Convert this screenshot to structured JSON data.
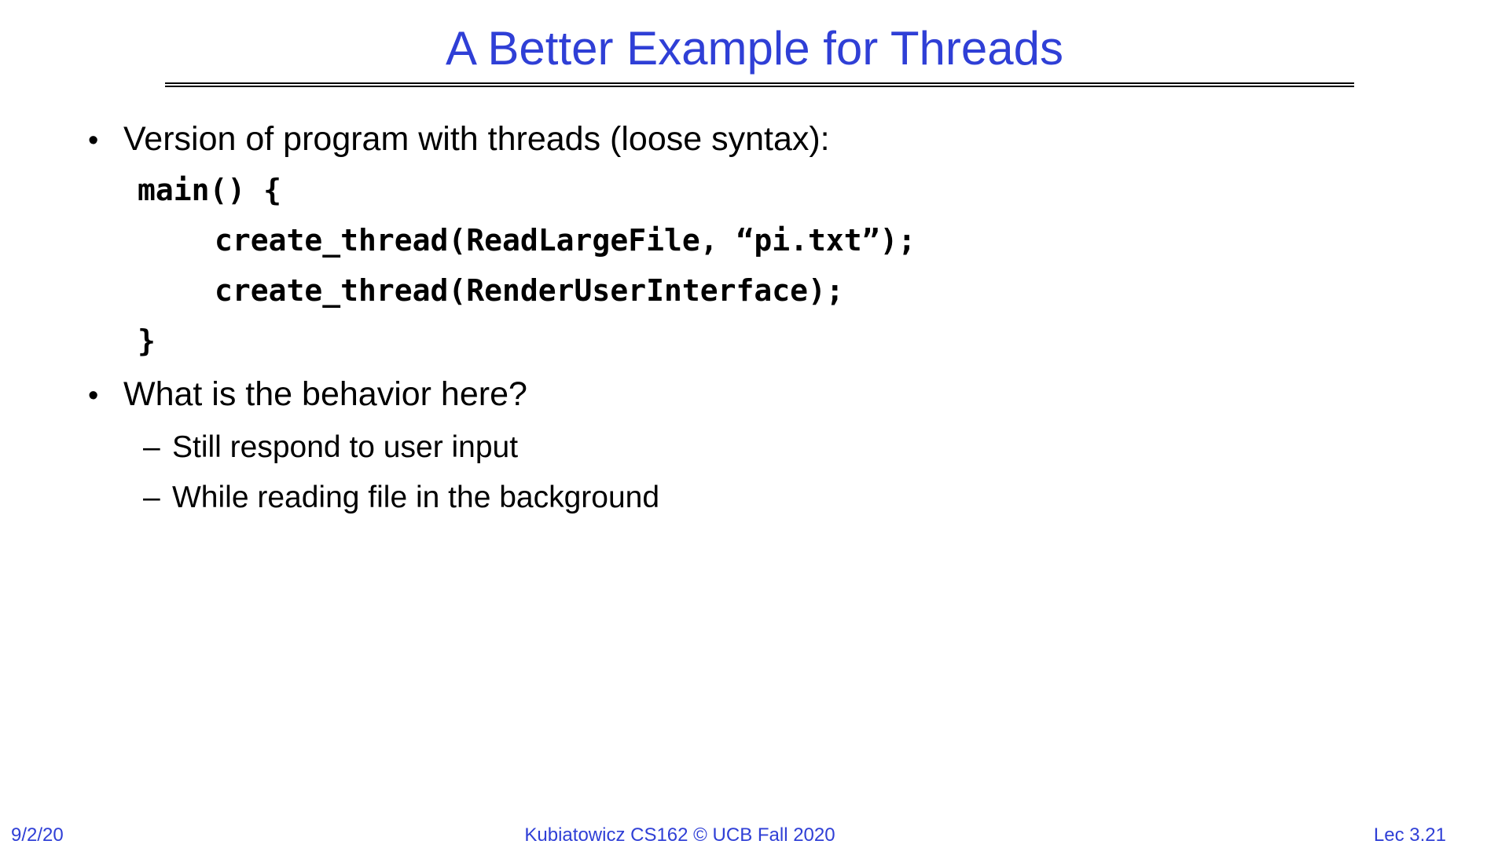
{
  "slide": {
    "title": "A Better Example for Threads",
    "bullets": [
      {
        "text": "Version of program with threads (loose syntax):",
        "code": [
          "main() {",
          "create_thread(ReadLargeFile, “pi.txt”);",
          "create_thread(RenderUserInterface);",
          "}"
        ]
      },
      {
        "text": "What is the behavior here?",
        "subitems": [
          "Still respond to user input",
          "While reading file in the background"
        ]
      }
    ],
    "bullet_symbol": "•",
    "sub_bullet_symbol": "–"
  },
  "footer": {
    "date": "9/2/20",
    "course": "Kubiatowicz CS162 © UCB Fall 2020",
    "lecture": "Lec 3.21"
  },
  "colors": {
    "title": "#2f3fd6",
    "footer": "#2f3fd6",
    "body_text": "#000000"
  }
}
